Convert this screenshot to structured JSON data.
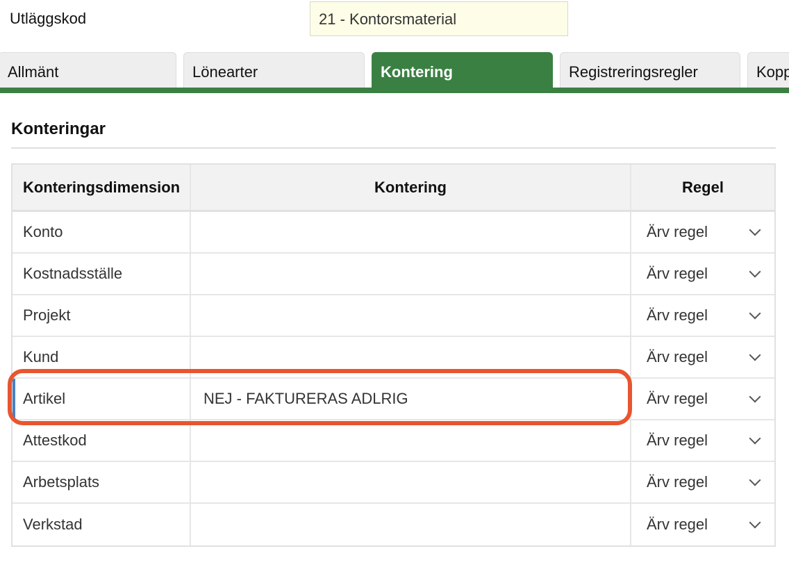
{
  "form": {
    "field_label": "Utläggskod",
    "field_value": "21 - Kontorsmaterial"
  },
  "tabs": [
    {
      "label": "Allmänt",
      "active": false
    },
    {
      "label": "Lönearter",
      "active": false
    },
    {
      "label": "Kontering",
      "active": true
    },
    {
      "label": "Registreringsregler",
      "active": false
    },
    {
      "label": "Kopp",
      "active": false
    }
  ],
  "section": {
    "title": "Konteringar"
  },
  "table": {
    "headers": [
      "Konteringsdimension",
      "Kontering",
      "Regel"
    ],
    "rows": [
      {
        "dimension": "Konto",
        "kontering": "",
        "regel": "Ärv regel",
        "selected": false
      },
      {
        "dimension": "Kostnadsställe",
        "kontering": "",
        "regel": "Ärv regel",
        "selected": false
      },
      {
        "dimension": "Projekt",
        "kontering": "",
        "regel": "Ärv regel",
        "selected": false
      },
      {
        "dimension": "Kund",
        "kontering": "",
        "regel": "Ärv regel",
        "selected": false
      },
      {
        "dimension": "Artikel",
        "kontering": "NEJ - FAKTURERAS ADLRIG",
        "regel": "Ärv regel",
        "selected": true
      },
      {
        "dimension": "Attestkod",
        "kontering": "",
        "regel": "Ärv regel",
        "selected": false
      },
      {
        "dimension": "Arbetsplats",
        "kontering": "",
        "regel": "Ärv regel",
        "selected": false
      },
      {
        "dimension": "Verkstad",
        "kontering": "",
        "regel": "Ärv regel",
        "selected": false
      }
    ]
  },
  "colors": {
    "accent_green": "#3a8043",
    "highlight_red": "#e8552f",
    "selected_marker_blue": "#4a7fc1",
    "input_background": "#fdfde8"
  },
  "icons": {
    "dropdown": "chevron-down-icon"
  }
}
